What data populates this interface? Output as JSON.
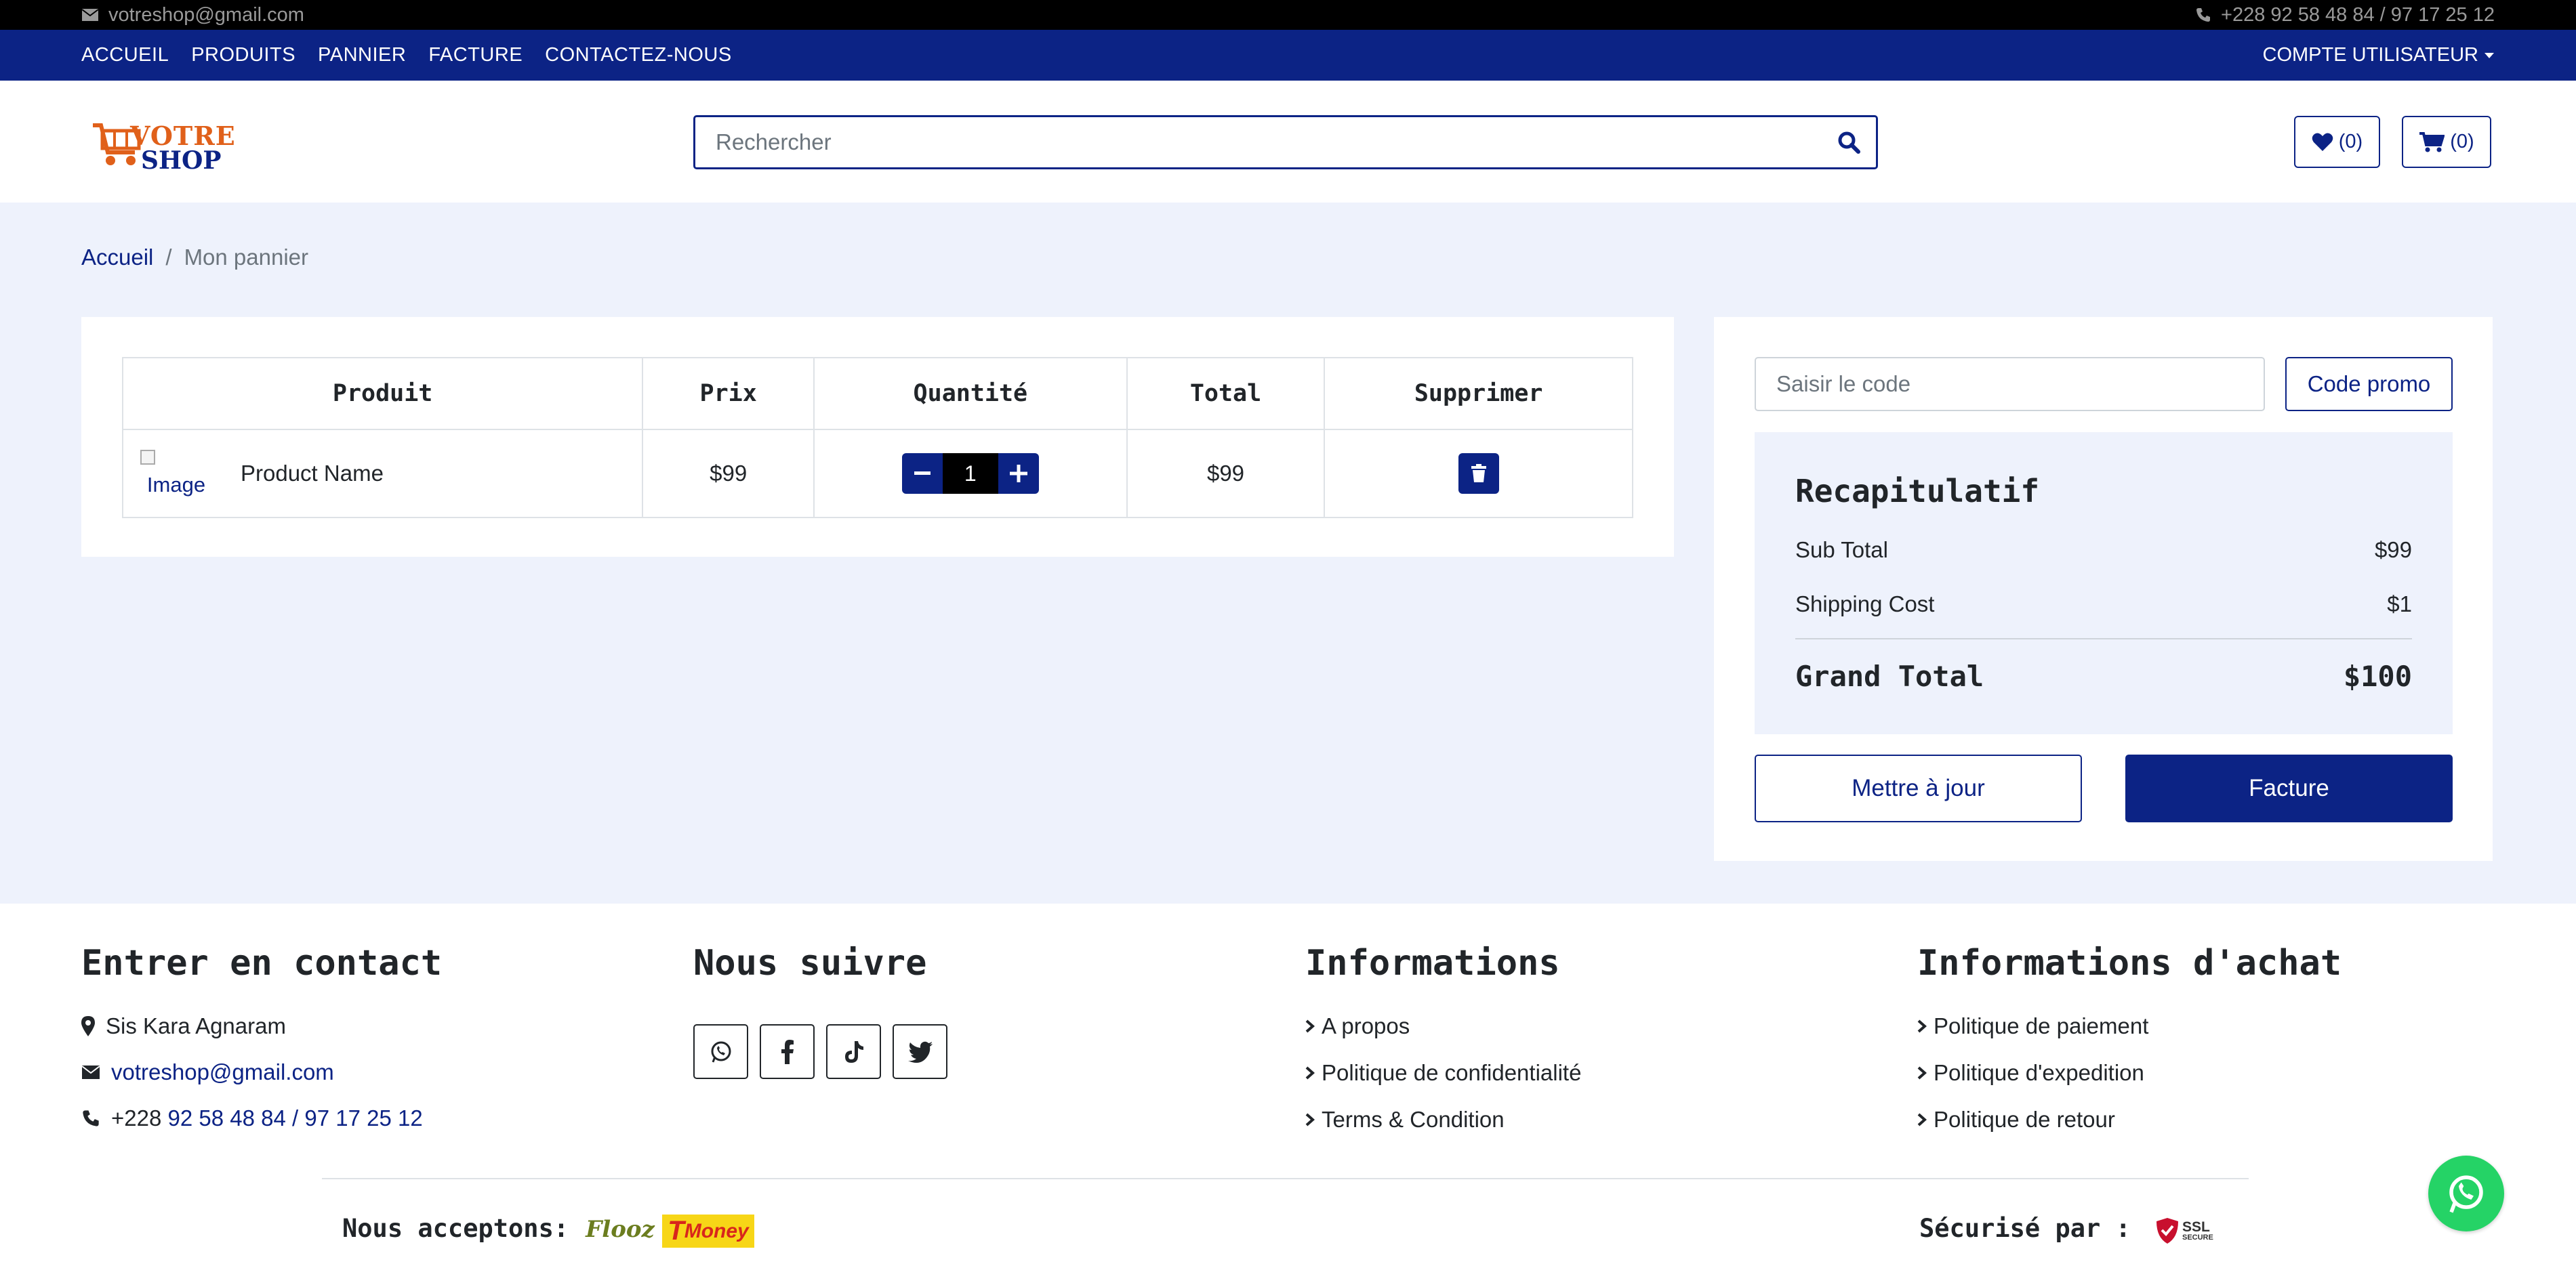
{
  "topbar": {
    "email": "votreshop@gmail.com",
    "phone": "+228 92 58 48 84 / 97 17 25 12"
  },
  "nav": {
    "links": [
      "ACCUEIL",
      "PRODUITS",
      "PANNIER",
      "FACTURE",
      "CONTACTEZ-NOUS"
    ],
    "account": "COMPTE UTILISATEUR"
  },
  "header": {
    "logo_line1": "VOTRE",
    "logo_line2": "SHOP",
    "search_placeholder": "Rechercher",
    "wishlist_count": "(0)",
    "cart_count": "(0)"
  },
  "breadcrumb": {
    "home": "Accueil",
    "separator": "/",
    "current": "Mon pannier"
  },
  "cart": {
    "columns": [
      "Produit",
      "Prix",
      "Quantité",
      "Total",
      "Supprimer"
    ],
    "rows": [
      {
        "image_alt": "Image",
        "name": "Product Name",
        "price": "$99",
        "quantity": "1",
        "total": "$99"
      }
    ],
    "minus": "−",
    "plus": "+"
  },
  "summary": {
    "promo_placeholder": "Saisir le code",
    "promo_button": "Code promo",
    "title": "Recapitulatif",
    "subtotal_label": "Sub Total",
    "subtotal_value": "$99",
    "shipping_label": "Shipping Cost",
    "shipping_value": "$1",
    "grand_label": "Grand Total",
    "grand_value": "$100",
    "update_button": "Mettre à jour",
    "invoice_button": "Facture"
  },
  "footer": {
    "contact": {
      "heading": "Entrer en contact",
      "address": "Sis Kara Agnaram",
      "email": "votreshop@gmail.com",
      "phone_prefix": "+228",
      "phone_rest": "92 58 48 84 / 97 17 25 12"
    },
    "follow": {
      "heading": "Nous suivre",
      "icons": [
        "whatsapp-icon",
        "facebook-icon",
        "tiktok-icon",
        "twitter-icon"
      ]
    },
    "info": {
      "heading": "Informations",
      "links": [
        "A propos",
        "Politique de confidentialité",
        "Terms & Condition"
      ]
    },
    "purchase": {
      "heading": "Informations d'achat",
      "links": [
        "Politique de paiement",
        "Politique d'expedition",
        "Politique de retour"
      ]
    },
    "accept_label": "Nous acceptons:",
    "flooz_logo": "Flooz",
    "tmoney_logo_t": "T",
    "tmoney_logo_rest": "Money",
    "secured_label": "Sécurisé par :",
    "ssl_badge_line1": "SSL",
    "ssl_badge_line2": "SECURE"
  },
  "colors": {
    "brand": "#0c2385",
    "topbar_bg": "#000000",
    "page_bg": "#eef2fc",
    "whatsapp": "#25d366"
  }
}
